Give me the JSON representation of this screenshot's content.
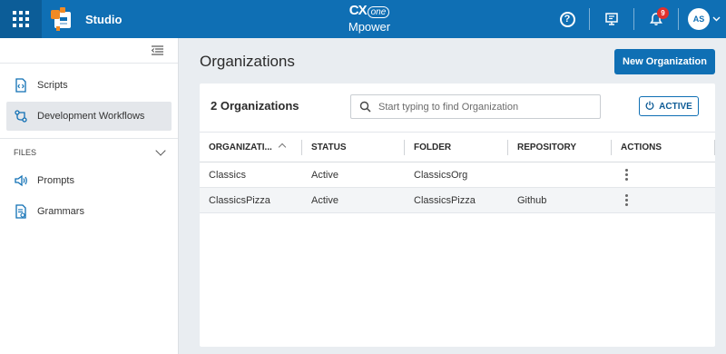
{
  "app": {
    "title": "Studio",
    "brand_line1": "CX",
    "brand_one": "one",
    "brand_line2": "Mpower"
  },
  "topbar": {
    "help_icon": "help-circle-icon",
    "notification_count": "9",
    "avatar_initials": "AS"
  },
  "sidebar": {
    "items": [
      {
        "label": "Scripts",
        "icon": "script-icon"
      },
      {
        "label": "Development Workflows",
        "icon": "workflow-icon",
        "active": true
      }
    ],
    "files_header": "FILES",
    "file_items": [
      {
        "label": "Prompts",
        "icon": "speaker-icon"
      },
      {
        "label": "Grammars",
        "icon": "grammar-icon"
      }
    ]
  },
  "main": {
    "page_title": "Organizations",
    "new_button": "New Organization",
    "count_label": "2 Organizations",
    "search_placeholder": "Start typing to find Organization",
    "filter_button": "ACTIVE",
    "columns": [
      "ORGANIZATI...",
      "STATUS",
      "FOLDER",
      "REPOSITORY",
      "ACTIONS"
    ],
    "rows": [
      {
        "organization": "Classics",
        "status": "Active",
        "folder": "ClassicsOrg",
        "repository": ""
      },
      {
        "organization": "ClassicsPizza",
        "status": "Active",
        "folder": "ClassicsPizza",
        "repository": "Github"
      }
    ]
  },
  "colors": {
    "brand_blue": "#0f6fb4",
    "badge_red": "#e0302c",
    "accent_orange": "#f08a24"
  }
}
